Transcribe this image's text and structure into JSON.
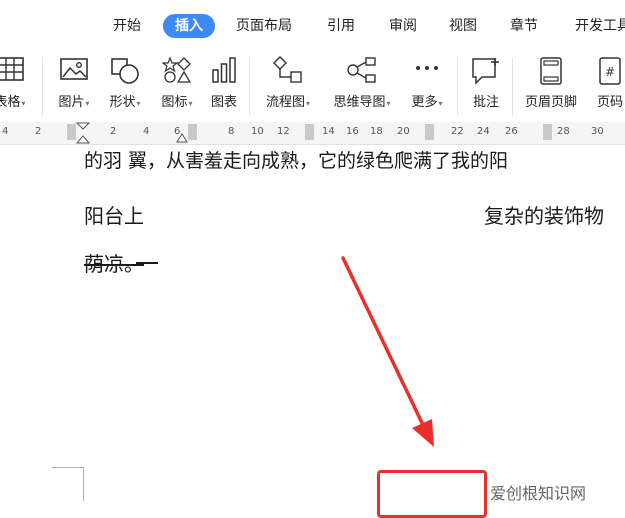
{
  "tabs": [
    "开始",
    "插入",
    "页面布局",
    "引用",
    "审阅",
    "视图",
    "章节",
    "开发工具"
  ],
  "active_tab": "插入",
  "toolbar": {
    "table": "表格",
    "picture": "图片",
    "shape": "形状",
    "icon": "图标",
    "chart": "图表",
    "flowchart": "流程图",
    "mindmap": "思维导图",
    "more": "更多",
    "comment": "批注",
    "header_footer": "页眉页脚",
    "page_number": "页码"
  },
  "ruler": [
    "4",
    "2",
    "2",
    "4",
    "6",
    "8",
    "10",
    "12",
    "14",
    "16",
    "18",
    "20",
    "22",
    "24",
    "26",
    "28",
    "30"
  ],
  "document": {
    "line1": "的羽 翼，从害羞走向成熟，它的绿色爬满了我的阳",
    "line2a": "阳台上",
    "line2b": "复杂的装饰物",
    "line3": "荫凉。"
  },
  "watermark": "爱创根知识网",
  "colors": {
    "accent": "#3f89f5",
    "annotation": "#e8302a"
  }
}
